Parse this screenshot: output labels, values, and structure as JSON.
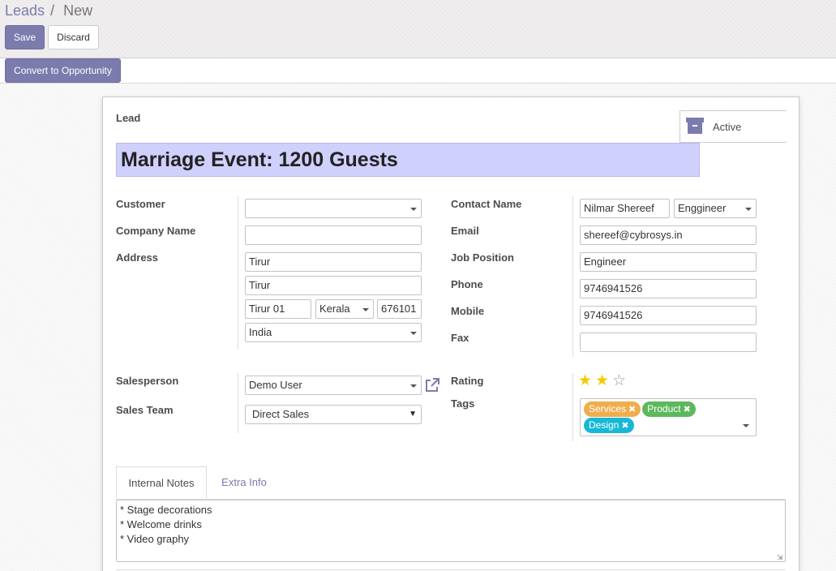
{
  "breadcrumb": {
    "parent": "Leads",
    "separator": "/",
    "current": "New"
  },
  "buttons": {
    "save": "Save",
    "discard": "Discard",
    "convert": "Convert to Opportunity",
    "active": "Active"
  },
  "form": {
    "lead_label": "Lead",
    "title": "Marriage Event: 1200 Guests",
    "labels": {
      "customer": "Customer",
      "company_name": "Company Name",
      "address": "Address",
      "contact_name": "Contact Name",
      "email": "Email",
      "job_position": "Job Position",
      "phone": "Phone",
      "mobile": "Mobile",
      "fax": "Fax",
      "salesperson": "Salesperson",
      "sales_team": "Sales Team",
      "rating": "Rating",
      "tags": "Tags"
    },
    "values": {
      "customer": "",
      "company_name": "",
      "street": "Tirur",
      "street2": "Tirur",
      "city": "Tirur 01",
      "state": "Kerala",
      "zip": "676101",
      "country": "India",
      "contact_name": "Nilmar Shereef",
      "title": "Enggineer",
      "email": "shereef@cybrosys.in",
      "job_position": "Engineer",
      "phone": "9746941526",
      "mobile": "9746941526",
      "fax": "",
      "salesperson": "Demo User",
      "sales_team": "Direct Sales",
      "rating": 2,
      "rating_max": 3
    },
    "tags": [
      {
        "label": "Services",
        "color": "#f0ad4e"
      },
      {
        "label": "Product",
        "color": "#5cb85c"
      },
      {
        "label": "Design",
        "color": "#17b8d6"
      }
    ]
  },
  "tabs": {
    "internal_notes": "Internal Notes",
    "extra_info": "Extra Info"
  },
  "notes": "* Stage decorations\n* Welcome drinks\n* Video graphy",
  "colors": {
    "primary": "#7c7bad",
    "title_bg": "#d0d0fc",
    "star": "#f3cc00"
  },
  "icons": {
    "archive": "archive-icon",
    "external_link": "external-link-icon",
    "star": "star-icon"
  }
}
